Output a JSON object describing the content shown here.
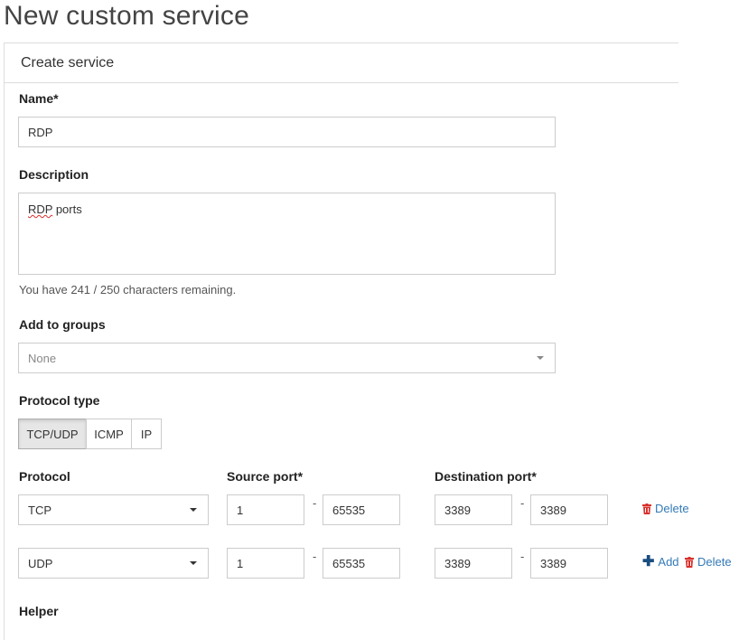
{
  "page": {
    "title": "New custom service"
  },
  "panel": {
    "title": "Create service"
  },
  "form": {
    "name_label": "Name*",
    "name_value": "RDP",
    "description_label": "Description",
    "description_value_word1": "RDP",
    "description_value_rest": " ports",
    "char_hint": "You have 241 / 250 characters remaining.",
    "groups_label": "Add to groups",
    "groups_value": "None",
    "protocol_type_label": "Protocol type",
    "protocol_types": [
      "TCP/UDP",
      "ICMP",
      "IP"
    ],
    "protocol_type_selected": "TCP/UDP",
    "protocol_col": "Protocol",
    "source_col": "Source port*",
    "dest_col": "Destination port*",
    "rows": [
      {
        "protocol": "TCP",
        "src_from": "1",
        "src_to": "65535",
        "dst_from": "3389",
        "dst_to": "3389"
      },
      {
        "protocol": "UDP",
        "src_from": "1",
        "src_to": "65535",
        "dst_from": "3389",
        "dst_to": "3389"
      }
    ],
    "range_sep": "-",
    "delete_label": "Delete",
    "add_label": "Add",
    "helper_label": "Helper"
  },
  "colors": {
    "danger": "#d9302c",
    "link": "#337ab7",
    "accent_dark": "#1a4d80"
  },
  "icons": {
    "delete": "trash-icon",
    "add": "plus-icon",
    "dropdown": "caret-down-icon"
  }
}
